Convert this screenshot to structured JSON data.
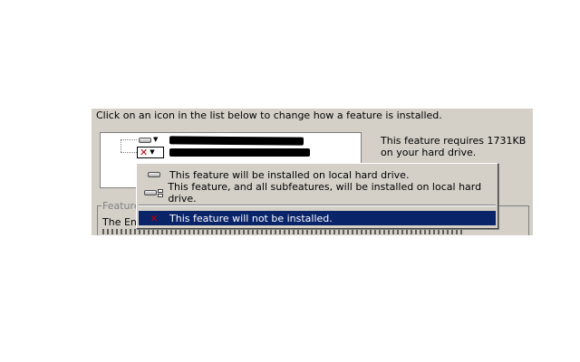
{
  "dialog": {
    "instruction": "Click on an icon in the list below to change how a feature is installed.",
    "info_text": "This feature requires 1731KB on your hard drive.",
    "group_label": "Feature",
    "description_start": "The Ent"
  },
  "tree": {
    "items": [
      {
        "icon": "hard-drive-icon",
        "state": "install-local"
      },
      {
        "icon": "red-x-icon",
        "state": "not-installed"
      }
    ]
  },
  "menu": {
    "items": [
      {
        "icon": "hard-drive-icon",
        "label": "This feature will be installed on local hard drive."
      },
      {
        "icon": "hard-drive-subfeatures-icon",
        "label": "This feature, and all subfeatures, will be installed on local hard drive."
      },
      {
        "icon": "red-x-icon",
        "label": "This feature will not be installed.",
        "selected": true
      }
    ]
  },
  "colors": {
    "dialog_bg": "#d4d0c8",
    "highlight": "#0a246a",
    "x_red": "#c00000"
  }
}
